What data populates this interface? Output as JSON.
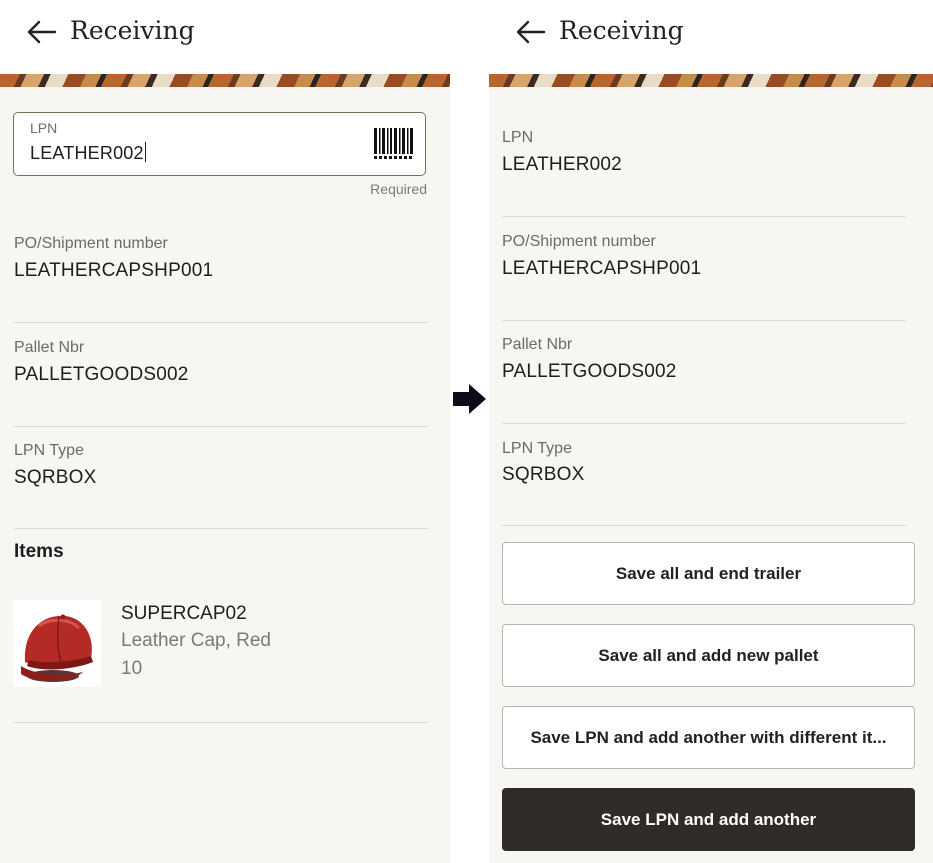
{
  "left_screen": {
    "header": {
      "title": "Receiving",
      "back_icon": "arrow-left-icon"
    },
    "lpn": {
      "label": "LPN",
      "value": "LEATHER002",
      "required_text": "Required",
      "barcode_icon": "barcode-icon"
    },
    "po_shipment": {
      "label": "PO/Shipment number",
      "value": "LEATHERCAPSHP001"
    },
    "pallet": {
      "label": "Pallet Nbr",
      "value": "PALLETGOODS002"
    },
    "lpn_type": {
      "label": "LPN Type",
      "value": "SQRBOX"
    },
    "items": {
      "heading": "Items",
      "list": [
        {
          "code": "SUPERCAP02",
          "description": "Leather Cap, Red",
          "quantity": "10",
          "image": "red-leather-cap"
        }
      ]
    }
  },
  "transition_icon": "right-arrow-icon",
  "right_screen": {
    "header": {
      "title": "Receiving",
      "back_icon": "arrow-left-icon"
    },
    "lpn": {
      "label": "LPN",
      "value": "LEATHER002"
    },
    "po_shipment": {
      "label": "PO/Shipment number",
      "value": "LEATHERCAPSHP001"
    },
    "pallet": {
      "label": "Pallet Nbr",
      "value": "PALLETGOODS002"
    },
    "lpn_type": {
      "label": "LPN Type",
      "value": "SQRBOX"
    },
    "actions": [
      {
        "label": "Save all and end trailer",
        "style": "secondary"
      },
      {
        "label": "Save all and add new pallet",
        "style": "secondary"
      },
      {
        "label": "Save LPN and add another with different it...",
        "style": "secondary"
      },
      {
        "label": "Save LPN and add another",
        "style": "primary"
      }
    ]
  },
  "colors": {
    "background": "#f7f6f3",
    "input_border": "#6d7b55",
    "primary_button": "#2e2b28",
    "label_text": "#6b6b6b"
  }
}
